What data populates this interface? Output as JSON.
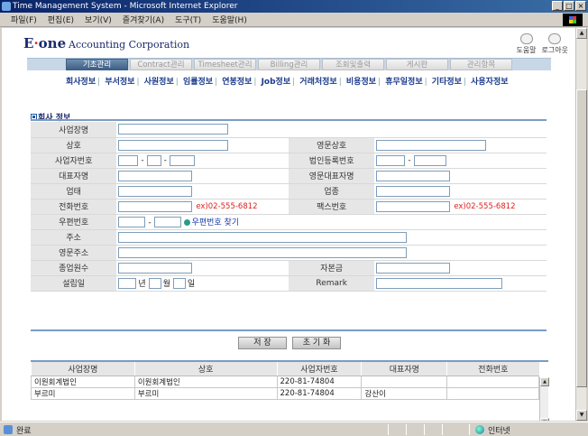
{
  "window": {
    "title": "Time Management System - Microsoft Internet Explorer",
    "controls": [
      "_",
      "□",
      "×"
    ]
  },
  "menu": [
    "파일(F)",
    "편집(E)",
    "보기(V)",
    "즐겨찾기(A)",
    "도구(T)",
    "도움말(H)"
  ],
  "header": {
    "logo_mark": "E",
    "logo_dot": "·",
    "logo_rest": "one",
    "company": "Accounting Corporation",
    "links": [
      {
        "label": "도움말",
        "icon": "help-icon"
      },
      {
        "label": "로그아웃",
        "icon": "logout-icon"
      }
    ]
  },
  "main_nav": {
    "tabs": [
      "기초관리",
      "Contract관리",
      "Timesheet관리",
      "Billing관리",
      "조회및출력",
      "게시판",
      "관리항목"
    ],
    "active_index": 0
  },
  "sub_nav": [
    "회사정보",
    "부서정보",
    "사원정보",
    "임률정보",
    "연봉정보",
    "Job정보",
    "거래처정보",
    "비용정보",
    "휴무일정보",
    "기타정보",
    "사용자정보"
  ],
  "section_title": "회사 정보",
  "form": {
    "labels": {
      "biz_name": "사업장명",
      "company_name": "상호",
      "company_name_en": "영문상호",
      "biz_reg_no": "사업자번호",
      "corp_reg_no": "법인등록번호",
      "ceo": "대표자명",
      "ceo_en": "영문대표자명",
      "biz_type": "업태",
      "biz_item": "업종",
      "phone": "전화번호",
      "fax": "팩스번호",
      "zip": "우편번호",
      "address": "주소",
      "address_en": "영문주소",
      "employees": "종업원수",
      "capital": "자본금",
      "established": "설립일",
      "remark": "Remark"
    },
    "values": {
      "biz_name": "",
      "company_name": "",
      "company_name_en": "",
      "biz_reg_no_1": "",
      "biz_reg_no_2": "",
      "biz_reg_no_3": "",
      "corp_reg_no_1": "",
      "corp_reg_no_2": "",
      "ceo": "",
      "ceo_en": "",
      "biz_type": "",
      "biz_item": "",
      "phone": "",
      "fax": "",
      "zip_1": "",
      "zip_2": "",
      "address": "",
      "address_en": "",
      "employees": "",
      "capital": "",
      "est_year": "",
      "est_month": "",
      "est_day": "",
      "remark": ""
    },
    "phone_hint": "ex)02-555-6812",
    "fax_hint": "ex)02-555-6812",
    "dash": "-",
    "zip_search": "우편번호 찾기",
    "year_unit": "년",
    "month_unit": "월",
    "day_unit": "일"
  },
  "buttons": {
    "save": "저 장",
    "reset": "초 기 화"
  },
  "grid": {
    "columns": [
      "사업장명",
      "상호",
      "사업자번호",
      "대표자명",
      "전화번호"
    ],
    "rows": [
      [
        "이원회계법인",
        "이원회계법인",
        "220-81-74804",
        "",
        ""
      ],
      [
        "부르미",
        "부르미",
        "220-81-74804",
        "강산이",
        ""
      ]
    ]
  },
  "status": {
    "text": "완료",
    "zone": "인터넷"
  }
}
